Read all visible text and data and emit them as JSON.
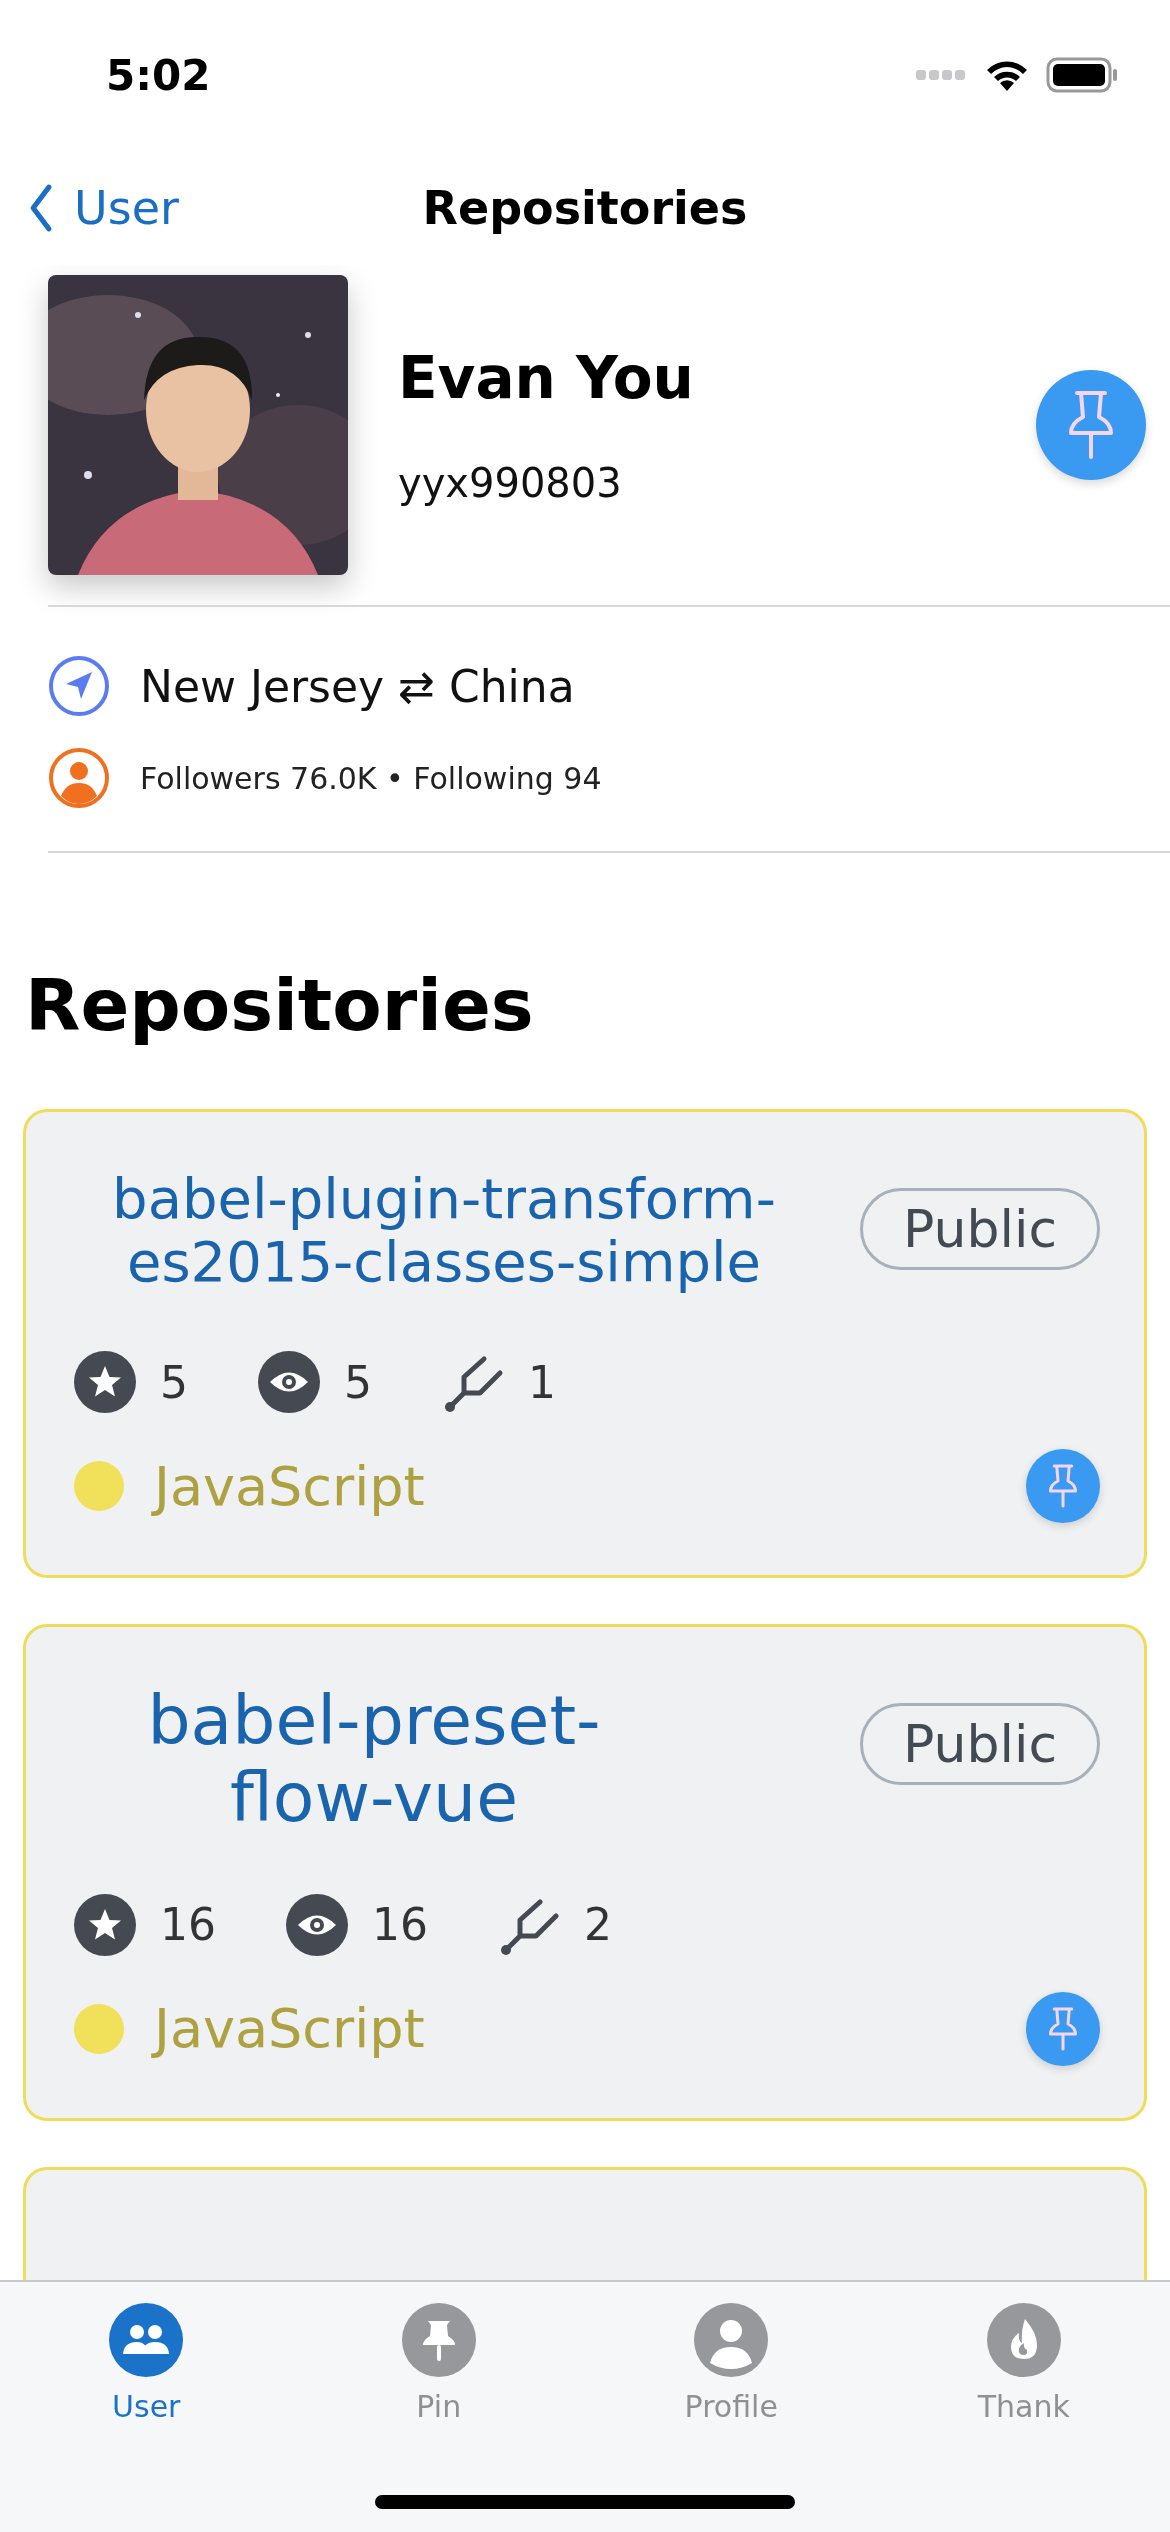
{
  "status_bar": {
    "time": "5:02"
  },
  "nav": {
    "back_label": "User",
    "title": "Repositories"
  },
  "profile": {
    "name": "Evan You",
    "username": "yyx990803",
    "location": "New Jersey ⇄ China",
    "follow_stats": "Followers 76.0K • Following 94"
  },
  "section_title": "Repositories",
  "repositories": [
    {
      "name": "babel-plugin-transform-es2015-classes-simple",
      "visibility": "Public",
      "star_count": "5",
      "watcher_count": "5",
      "fork_count": "1",
      "language": "JavaScript",
      "color": "#f1e05a"
    },
    {
      "name": "babel-preset-flow-vue",
      "visibility": "Public",
      "star_count": "16",
      "watcher_count": "16",
      "fork_count": "2",
      "language": "JavaScript",
      "color": "#f1e05a"
    }
  ],
  "tab_bar": [
    {
      "label": "User",
      "kind": "users",
      "selected": true
    },
    {
      "label": "Pin",
      "kind": "pin",
      "selected": false
    },
    {
      "label": "Profile",
      "kind": "person",
      "selected": false
    },
    {
      "label": "Thank",
      "kind": "flame",
      "selected": false
    }
  ]
}
